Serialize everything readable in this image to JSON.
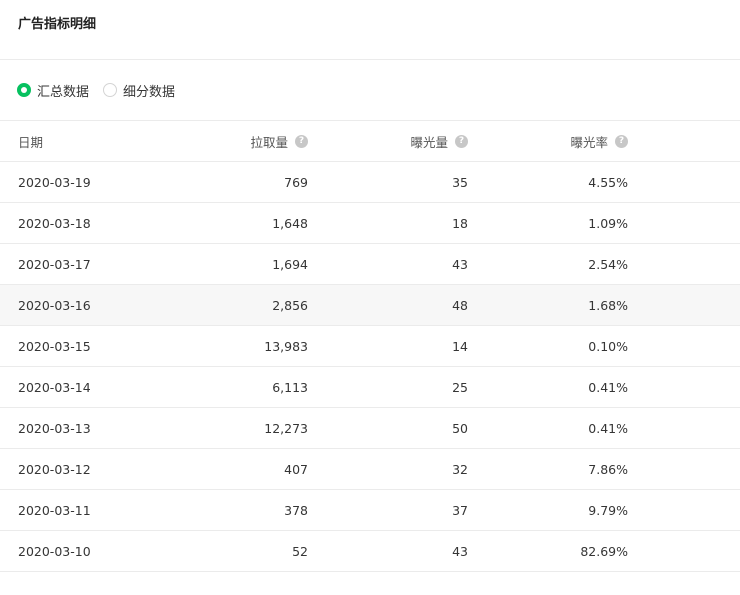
{
  "header": {
    "title": "广告指标明细"
  },
  "view_toggle": {
    "options": [
      {
        "label": "汇总数据",
        "checked": true
      },
      {
        "label": "细分数据",
        "checked": false
      }
    ]
  },
  "table": {
    "columns": [
      "日期",
      "拉取量",
      "曝光量",
      "曝光率"
    ],
    "rows": [
      {
        "date": "2020-03-19",
        "pulls": "769",
        "exposures": "35",
        "rate": "4.55%"
      },
      {
        "date": "2020-03-18",
        "pulls": "1,648",
        "exposures": "18",
        "rate": "1.09%"
      },
      {
        "date": "2020-03-17",
        "pulls": "1,694",
        "exposures": "43",
        "rate": "2.54%"
      },
      {
        "date": "2020-03-16",
        "pulls": "2,856",
        "exposures": "48",
        "rate": "1.68%"
      },
      {
        "date": "2020-03-15",
        "pulls": "13,983",
        "exposures": "14",
        "rate": "0.10%"
      },
      {
        "date": "2020-03-14",
        "pulls": "6,113",
        "exposures": "25",
        "rate": "0.41%"
      },
      {
        "date": "2020-03-13",
        "pulls": "12,273",
        "exposures": "50",
        "rate": "0.41%"
      },
      {
        "date": "2020-03-12",
        "pulls": "407",
        "exposures": "32",
        "rate": "7.86%"
      },
      {
        "date": "2020-03-11",
        "pulls": "378",
        "exposures": "37",
        "rate": "9.79%"
      },
      {
        "date": "2020-03-10",
        "pulls": "52",
        "exposures": "43",
        "rate": "82.69%"
      }
    ]
  },
  "colors": {
    "accent": "#07c160",
    "border": "#ebebeb",
    "row_highlight": "#f7f7f7",
    "help_icon": "#c7c7c7"
  },
  "icons": {
    "help": "question-circle-icon"
  }
}
